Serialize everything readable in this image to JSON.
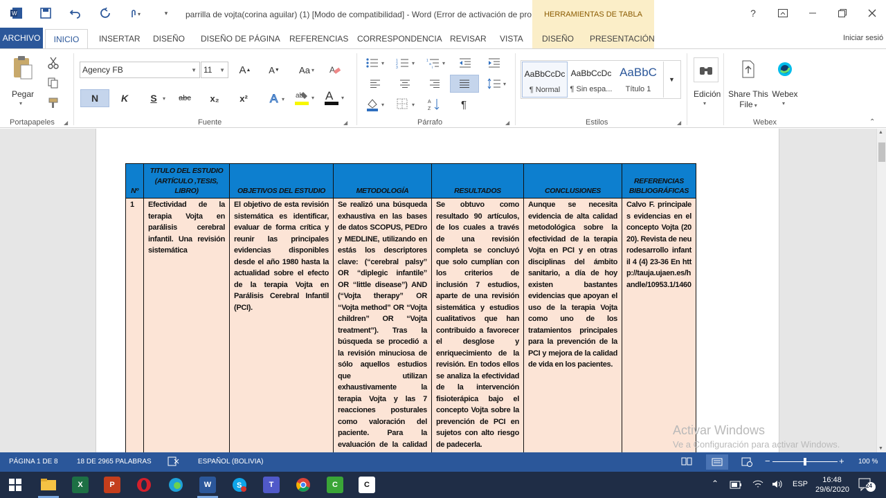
{
  "window": {
    "title": "parrilla de vojta(corina aguilar) (1) [Modo de compatibilidad] - Word (Error de activación de prod...",
    "contextual_group": "HERRAMIENTAS DE TABLA",
    "help": "?",
    "signin": "Iniciar sesió"
  },
  "tabs": [
    "ARCHIVO",
    "INICIO",
    "INSERTAR",
    "DISEÑO",
    "DISEÑO DE PÁGINA",
    "REFERENCIAS",
    "CORRESPONDENCIA",
    "REVISAR",
    "VISTA",
    "DISEÑO",
    "PRESENTACIÓN"
  ],
  "ribbon": {
    "clipboard": {
      "paste": "Pegar",
      "label": "Portapapeles"
    },
    "font": {
      "name": "Agency FB",
      "size": "11",
      "bold": "N",
      "italic": "K",
      "underline": "S",
      "strike": "abc",
      "sub": "x₂",
      "sup": "x²",
      "grow": "A",
      "shrink": "A",
      "case": "Aa",
      "label": "Fuente"
    },
    "paragraph": {
      "label": "Párrafo",
      "pilcrow": "¶"
    },
    "styles": {
      "items": [
        {
          "sample": "AaBbCcDc",
          "name": "¶ Normal"
        },
        {
          "sample": "AaBbCcDc",
          "name": "¶ Sin espa..."
        },
        {
          "sample": "AaBbC",
          "name": "Título 1"
        }
      ],
      "label": "Estilos"
    },
    "editing": {
      "label": "Edición"
    },
    "share": {
      "line1": "Share This",
      "line2": "File"
    },
    "webex": {
      "btn": "Webex",
      "label": "Webex"
    }
  },
  "table": {
    "headers": [
      "Nº",
      "TITULO DEL ESTUDIO (ARTÍCULO ,TESIS, LIBRO)",
      "OBJETIVOS DEL ESTUDIO",
      "METODOLOGÍA",
      "RESULTADOS",
      "CONCLUSIONES",
      "REFERENCIAS BIBLIOGRÁFICAS"
    ],
    "row": {
      "num": "1",
      "titulo": "Efectividad de la terapia Vojta en parálisis cerebral infantil. Una revisión sistemática",
      "objetivos": "El objetivo de esta revisión sistemática es identificar, evaluar de forma crítica y reunir las principales evidencias disponibles desde el año 1980 hasta la actualidad sobre el efecto de la terapia Vojta en Parálisis Cerebral Infantil (PCI).",
      "metodologia": "Se realizó una búsqueda exhaustiva en las bases de datos SCOPUS, PEDro y MEDLINE, utilizando en estás los descriptores clave: (“cerebral palsy” OR “diplegic infantile” OR “little disease”) AND (“Vojta therapy” OR “Vojta method” OR “Vojta children” OR “Vojta treatment”). Tras la búsqueda se procedió a la revisión minuciosa de sólo aquellos estudios que utilizan exhaustivamente la terapia Vojta y las 7 reacciones posturales como valoración del paciente. Para la evaluación de la calidad de los estudios seleccionados se utilizó",
      "resultados": "Se obtuvo como resultado 90 artículos, de los cuales a través de una revisión completa se concluyó que solo cumplían con los criterios de inclusión 7 estudios, aparte de una revisión sistemática y estudios cualitativos que han contribuido a favorecer el desglose y enriquecimiento de la revisión. En todos ellos se analiza la efectividad de la intervención fisioterápica bajo el concepto Vojta sobre la prevención de PCI en sujetos con alto riesgo de padecerla.",
      "conclusiones": "Aunque se necesita evidencia de alta calidad metodológica sobre la efectividad de la terapia Vojta en PCI y en otras disciplinas del ámbito sanitario, a día de hoy existen bastantes evidencias que apoyan el uso de la terapia Vojta como uno de los tratamientos principales para la prevención de la PCI y mejora de la calidad de vida en los pacientes.",
      "referencias": "Calvo F. principales evidencias en el concepto Vojta (2020). Revista de neurodesarrollo infantil 4 (4) 23-36 En http://tauja.ujaen.es/handle/10953.1/1460"
    }
  },
  "watermark": {
    "line1": "Activar Windows",
    "line2": "Ve a Configuración para activar Windows."
  },
  "status": {
    "page": "PÁGINA 1 DE 8",
    "words": "18 DE 2965 PALABRAS",
    "lang": "ESPAÑOL (BOLIVIA)",
    "zoom": "100 %",
    "zoom_level": 1.0
  },
  "taskbar": {
    "lang": "ESP",
    "time": "16:48",
    "date": "29/6/2020",
    "notifications": "24"
  }
}
